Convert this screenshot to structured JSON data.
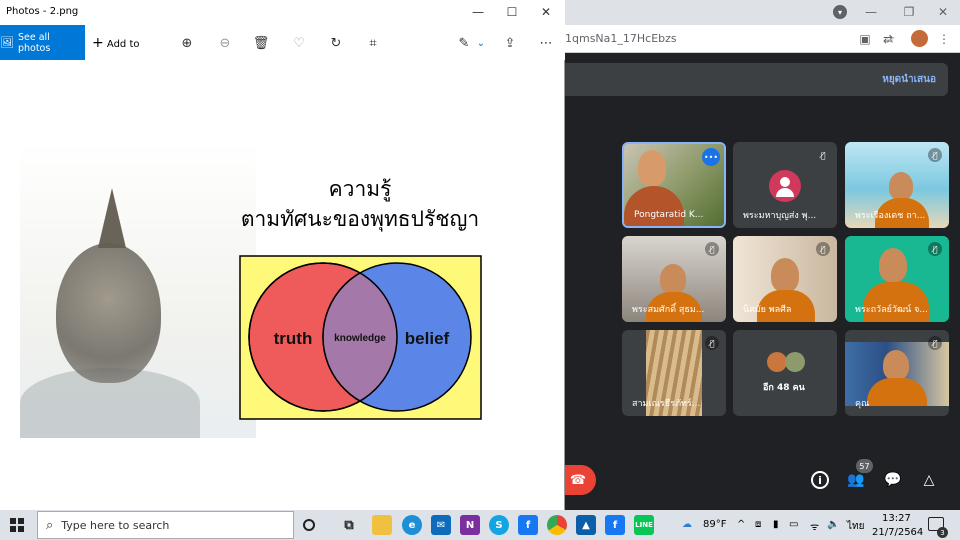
{
  "photos_window": {
    "title": "Photos - 2.png",
    "see_all_label": "See all photos",
    "add_to_label": "Add to"
  },
  "slide": {
    "title_line1": "ความรู้",
    "title_line2": "ตามทัศนะของพุทธปรัชญา",
    "venn_left": "truth",
    "venn_middle": "knowledge",
    "venn_right": "belief",
    "colors": {
      "left": "#ef5b5b",
      "right": "#5b86e8",
      "overlap": "#a478a8",
      "background": "#fff97a"
    }
  },
  "browser": {
    "url_fragment": "1qmsNa1_17HcEbzs"
  },
  "meet": {
    "stop_presenting": "หยุดนำเสนอ",
    "participants": [
      {
        "name": "Pongtaratid K..."
      },
      {
        "name": "พระมหาบุญส่ง พุ..."
      },
      {
        "name": "พระเรืองเดช ถา..."
      },
      {
        "name": "พระสมศักดิ์ สุธม..."
      },
      {
        "name": "นิสมัย พลศีล"
      },
      {
        "name": "พระถวัลย์วัฒน์ จ..."
      },
      {
        "name": "สามเณรธีรภัทร์..."
      },
      {
        "name": "อีก 48 คน"
      },
      {
        "name": "คุณ"
      }
    ],
    "people_count": "57"
  },
  "taskbar": {
    "search_placeholder": "Type here to search",
    "weather": "89°F",
    "language": "ไทย",
    "time": "13:27",
    "date": "21/7/2564",
    "notifications": "3"
  }
}
